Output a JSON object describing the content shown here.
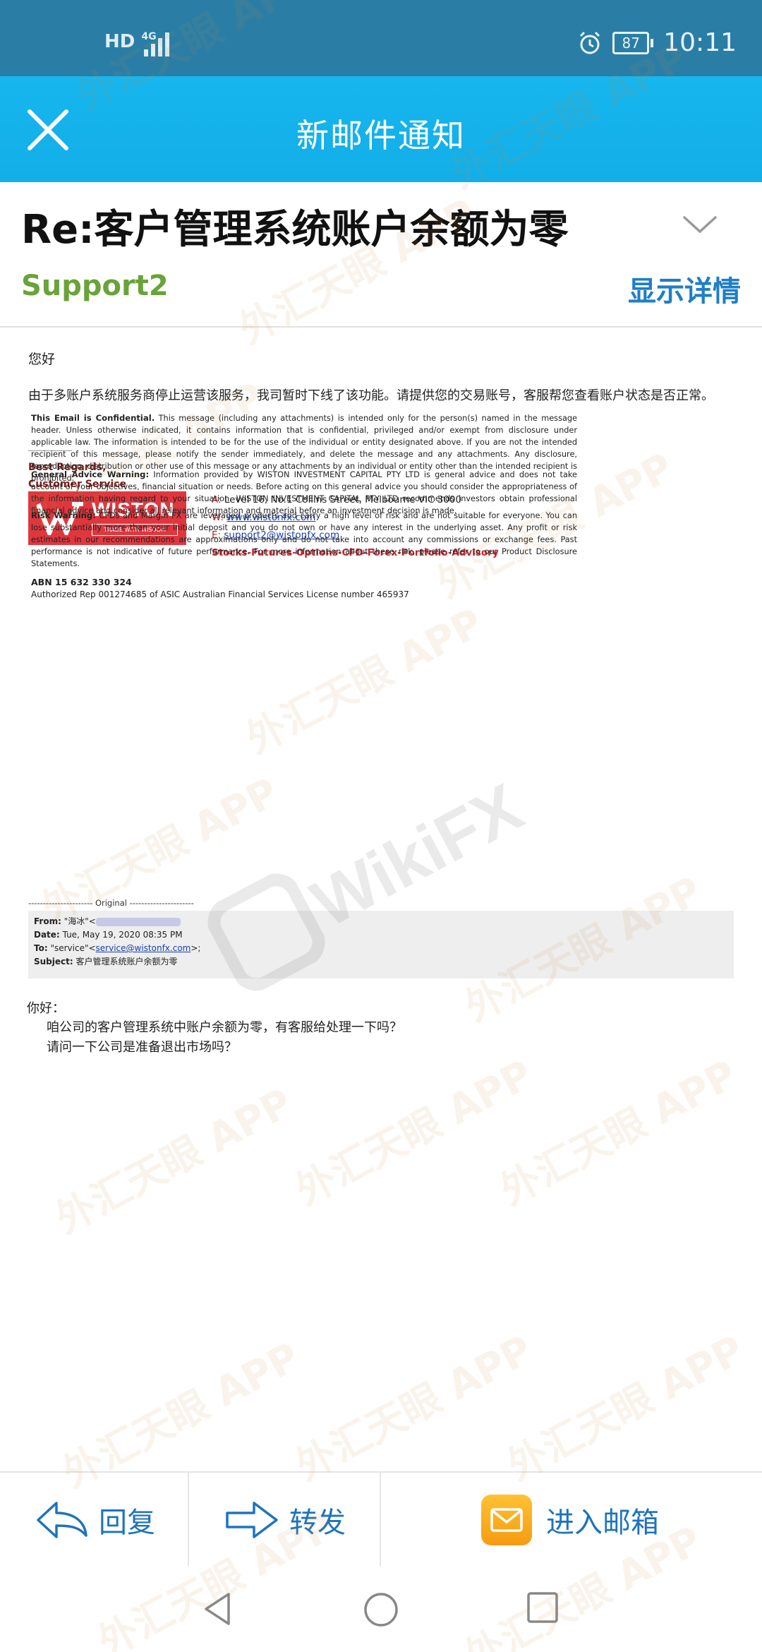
{
  "status_bar": {
    "network": "HD",
    "network_type": "4G",
    "battery": "87",
    "time": "10:11"
  },
  "header": {
    "title": "新邮件通知"
  },
  "email": {
    "subject": "Re:客户管理系统账户余额为零",
    "sender": "Support2",
    "details_link": "显示详情",
    "greeting": "您好",
    "body": "由于多账户系统服务商停止运营该服务，我司暂时下线了该功能。请提供您的交易账号，客服帮您查看账户状态是否正常。",
    "signature": {
      "regards": "Best Regards,",
      "team": "Customer Service",
      "logo_name": "WISTON",
      "logo_tagline": "TRADE WITH WISDOM",
      "address_key": "A:",
      "address": "Level 16, No.1 Collins Street, Melbourne VIC 3000",
      "web_key": "W:",
      "web": "www.wistonfx.com",
      "email_key": "E:",
      "email": "support2@wistonfx.com",
      "slogan": "Stocks-Futures-Options-CFD-Forex-Portfolio-Advisory",
      "abn": "ABN 15 632 330 324",
      "authorized": "Authorized Rep 001274685 of ASIC Australian Financial Services License number 465937"
    },
    "legal": [
      {
        "title": "This Email is Confidential.",
        "text": "This message (including any attachments) is intended only for the person(s) named in the message header. Unless otherwise indicated, it contains information that is confidential, privileged and/or exempt from disclosure under applicable law. The information is intended to be for the use of the individual or entity designated above. If you are not the intended recipient of this message, please notify the sender immediately, and delete the message and any attachments. Any disclosure, reproduction, distribution or other use of this message or any attachments by an individual or entity other than the intended recipient is prohibited."
      },
      {
        "title": "General Advice Warning:",
        "text": "Information provided by WISTON INVESTMENT CAPITAL PTY LTD is general advice and does not take account of your objectives, financial situation or needs. Before acting on this general advice you should consider the appropriateness of the information having regard to your situation. WISTON INVESTMENT CAPITAL PTY LTD recommends investors obtain professional financial advice and consider all relevant information and material before an investment decision is made."
      },
      {
        "title": "Risk Warning:",
        "text": "CFDs and Margin FX are leveraged products and carry a high level of risk and are not suitable for everyone. You can lose substantially more than your initial deposit and you do not own or have any interest in the underlying asset. Any profit or risk estimates in our recommendations are approximations only and do not take into account any commissions or exchange fees. Past performance is not indicative of future performance. For more information about these risk, please refer to our Product Disclosure Statements."
      }
    ],
    "original": {
      "separator": "---------------------- Original ----------------------",
      "from_label": "From:",
      "from": "\"海冰\"<",
      "date_label": "Date:",
      "date": "Tue, May 19, 2020 08:35 PM",
      "to_label": "To:",
      "to_name": "\"service\"<",
      "to_email": "service@wistonfx.com",
      "to_end": ">;",
      "subject_label": "Subject:",
      "subject": "客户管理系统账户余额为零"
    },
    "reply_greeting": "你好：",
    "reply_lines": [
      "咱公司的客户管理系统中账户余额为零，有客服给处理一下吗？",
      "请问一下公司是准备退出市场吗？"
    ]
  },
  "toolbar": {
    "reply_label": "回复",
    "forward_label": "转发",
    "inbox_label": "进入邮箱"
  },
  "watermark": {
    "text": "外汇天眼 APP",
    "center_text": "WikiFX"
  },
  "colors": {
    "status_bar": "#2a7ea6",
    "header": "#17b6ee",
    "sender": "#69a33a",
    "link": "#1f7ec8",
    "logo": "#e0373e",
    "toolbar_text": "#1e74bb"
  }
}
